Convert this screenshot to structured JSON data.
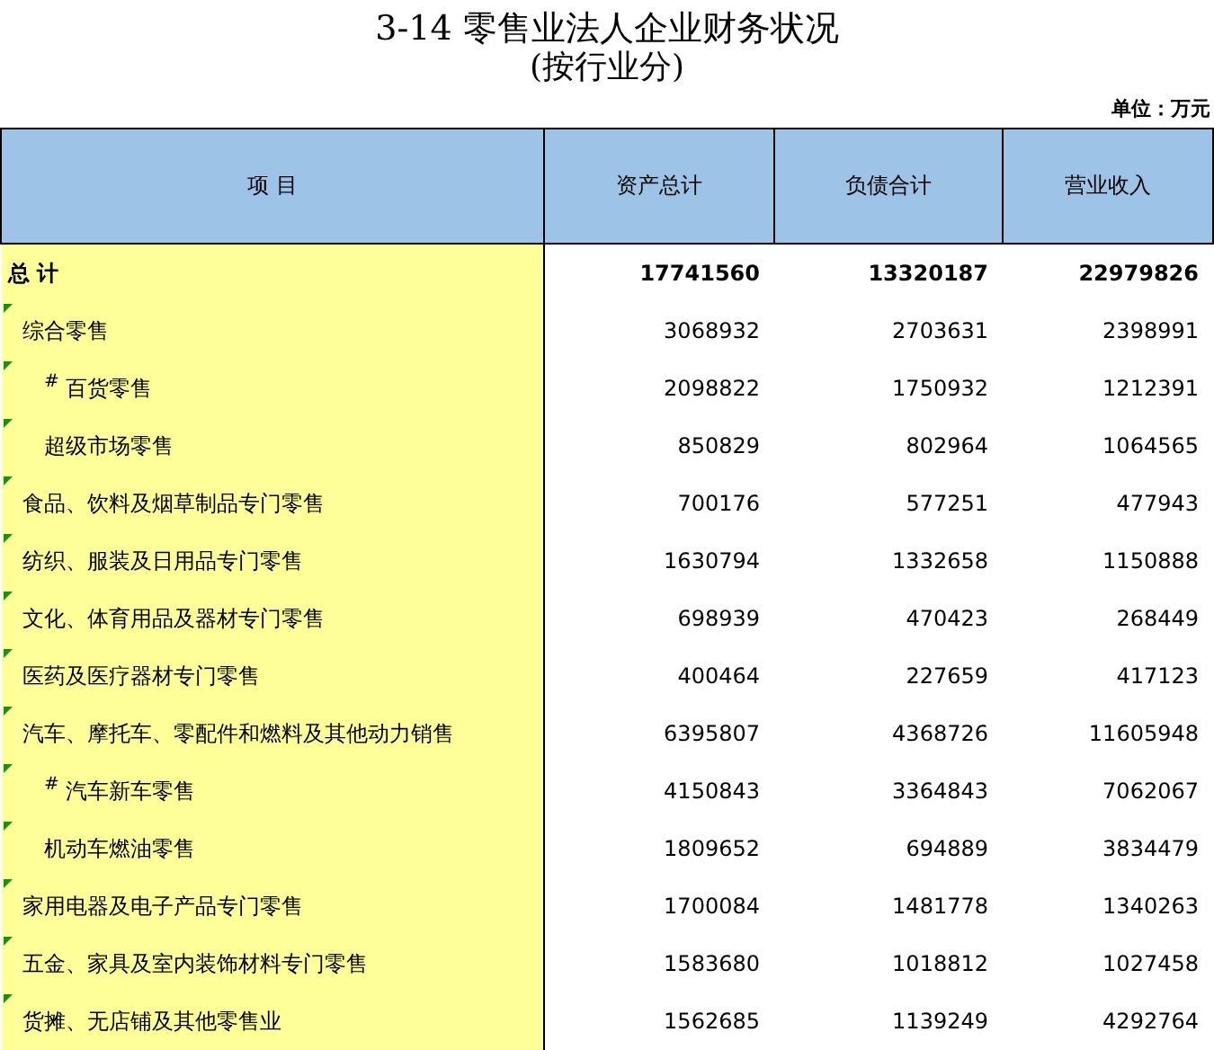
{
  "title": "3-14 零售业法人企业财务状况",
  "subtitle": "(按行业分)",
  "unit": "单位：万元",
  "columns": [
    "项  目",
    "资产总计",
    "负债合计",
    "营业收入"
  ],
  "rows": [
    {
      "name": "总  计",
      "kind": "total",
      "flagged": false,
      "values": [
        "17741560",
        "13320187",
        "22979826"
      ]
    },
    {
      "name": "综合零售",
      "kind": "item",
      "flagged": true,
      "values": [
        "3068932",
        "2703631",
        "2398991"
      ],
      "children": [
        {
          "name": "$^{#}$ 百货零售",
          "kind": "item",
          "flagged": true,
          "values": [
            "2098822",
            "1750932",
            "1212391"
          ]
        },
        {
          "name": "超级市场零售",
          "kind": "item",
          "flagged": true,
          "values": [
            "850829",
            "802964",
            "1064565"
          ]
        }
      ]
    },
    {
      "name": "食品、饮料及烟草制品专门零售",
      "kind": "item",
      "flagged": true,
      "values": [
        "700176",
        "577251",
        "477943"
      ]
    },
    {
      "name": "纺织、服装及日用品专门零售",
      "kind": "item",
      "flagged": true,
      "values": [
        "1630794",
        "1332658",
        "1150888"
      ]
    },
    {
      "name": "文化、体育用品及器材专门零售",
      "kind": "item",
      "flagged": true,
      "values": [
        "698939",
        "470423",
        "268449"
      ]
    },
    {
      "name": "医药及医疗器材专门零售",
      "kind": "item",
      "flagged": true,
      "values": [
        "400464",
        "227659",
        "417123"
      ]
    },
    {
      "name": "汽车、摩托车、零配件和燃料及其他动力销售",
      "kind": "item",
      "flagged": true,
      "values": [
        "6395807",
        "4368726",
        "11605948"
      ],
      "children": [
        {
          "name": "$^{#}$ 汽车新车零售",
          "kind": "item",
          "flagged": true,
          "values": [
            "4150843",
            "3364843",
            "7062067"
          ]
        },
        {
          "name": "机动车燃油零售",
          "kind": "item",
          "flagged": true,
          "values": [
            "1809652",
            "694889",
            "3834479"
          ]
        }
      ]
    },
    {
      "name": "家用电器及电子产品专门零售",
      "kind": "item",
      "flagged": true,
      "values": [
        "1700084",
        "1481778",
        "1340263"
      ]
    },
    {
      "name": "五金、家具及室内装饰材料专门零售",
      "kind": "item",
      "flagged": true,
      "values": [
        "1583680",
        "1018812",
        "1027458"
      ]
    },
    {
      "name": "货摊、无店铺及其他零售业",
      "kind": "item",
      "flagged": true,
      "values": [
        "1562685",
        "1139249",
        "4292764"
      ]
    }
  ]
}
